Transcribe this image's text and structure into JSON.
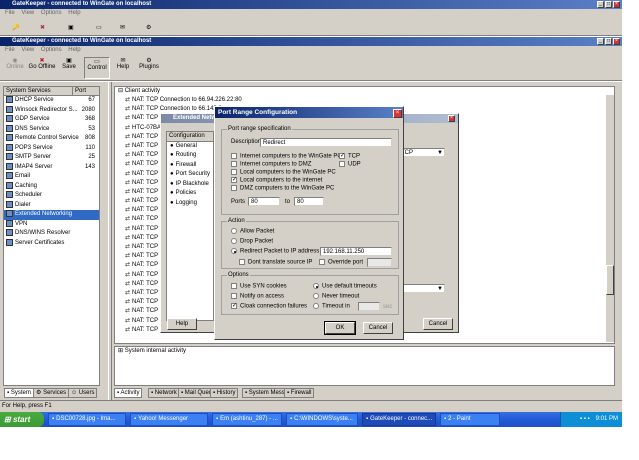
{
  "outer_window": {
    "title": "GateKeeper - connected to WinGate on localhost",
    "menu": [
      "File",
      "View",
      "Options",
      "Help"
    ]
  },
  "inner_window": {
    "title": "GateKeeper - connected to WinGate on localhost",
    "menu": [
      "File",
      "View",
      "Options",
      "Help"
    ],
    "toolbar": [
      "Online",
      "Go Offline",
      "Save",
      "Control",
      "Help",
      "Plugins"
    ]
  },
  "services": {
    "col_service": "System Services",
    "col_port": "Port",
    "items": [
      {
        "name": "DHCP Service",
        "port": "67"
      },
      {
        "name": "Winsock Redirector S...",
        "port": "2080"
      },
      {
        "name": "GDP Service",
        "port": "368"
      },
      {
        "name": "DNS Service",
        "port": "53"
      },
      {
        "name": "Remote Control Service",
        "port": "808"
      },
      {
        "name": "POP3 Service",
        "port": "110"
      },
      {
        "name": "SMTP Server",
        "port": "25"
      },
      {
        "name": "IMAP4 Server",
        "port": "143"
      },
      {
        "name": "Email",
        "port": ""
      },
      {
        "name": "Caching",
        "port": ""
      },
      {
        "name": "Scheduler",
        "port": ""
      },
      {
        "name": "Dialer",
        "port": ""
      },
      {
        "name": "Extended Networking",
        "port": ""
      },
      {
        "name": "VPN",
        "port": ""
      },
      {
        "name": "DNS/WINS Resolver",
        "port": ""
      },
      {
        "name": "Server Certificates",
        "port": ""
      }
    ],
    "tabs": [
      "System",
      "Services",
      "Users"
    ]
  },
  "activity": {
    "header": "Client activity",
    "lines": [
      "NAT: TCP Connection to 66.94.226.22:80",
      "NAT: TCP Connection to 66.142.2...",
      "NAT: TCP C",
      "HTC-07BAGE",
      "NAT: TCP C",
      "NAT: TCP C",
      "NAT: TCP C",
      "NAT: TCP C",
      "NAT: TCP C",
      "NAT: TCP C",
      "NAT: TCP C",
      "NAT: TCP C",
      "NAT: TCP C",
      "NAT: TCP C",
      "NAT: TCP C",
      "NAT: TCP C",
      "NAT: TCP C",
      "NAT: TCP C",
      "NAT: TCP C",
      "NAT: TCP C",
      "NAT: TCP C",
      "NAT: TCP C",
      "NAT: TCP C",
      "NAT: TCP C",
      "NAT: TCP C",
      "NAT: TCP Connection to 66.142.2..."
    ],
    "system_header": "System internal activity",
    "bottom_tabs": [
      "Activity",
      "Network",
      "Mail Queue",
      "History",
      "System Messages",
      "Firewall"
    ]
  },
  "extended_dialog": {
    "title": "Extended Netw",
    "nav": [
      "Configuration",
      "General",
      "Routing",
      "Firewall",
      "Port Security",
      "IP Blackhole",
      "Policies",
      "Logging"
    ],
    "tcp_value": "TCP",
    "help": "Help",
    "cancel": "Cancel"
  },
  "port_dialog": {
    "title": "Port Range Configuration",
    "spec_group": "Port range specification",
    "description_label": "Description",
    "description_value": "Redirect",
    "checks": [
      {
        "label": "Internet computers to the WinGate PC",
        "on": false
      },
      {
        "label": "Internet computers to DMZ",
        "on": false
      },
      {
        "label": "Local computers to the WinGate PC",
        "on": false
      },
      {
        "label": "Local computers to the internet",
        "on": true
      },
      {
        "label": "DMZ computers to the WinGate PC",
        "on": false
      }
    ],
    "tcp_label": "TCP",
    "udp_label": "UDP",
    "ports_label": "Ports",
    "port_from": "80",
    "to_label": "to",
    "port_to": "80",
    "action_group": "Action",
    "allow": "Allow Packet",
    "drop": "Drop Packet",
    "redirect": "Redirect Packet to IP address",
    "redirect_ip": "192.168.11.250",
    "dont_translate": "Dont translate source IP",
    "override_port": "Override port",
    "options_group": "Options",
    "use_syn": "Use SYN cookies",
    "use_default_timeouts": "Use default timeouts",
    "notify": "Notify on access",
    "never_timeout": "Never timeout",
    "cloak": "Cloak connection failures",
    "timeout_in": "Timeout in",
    "timeout_unit": "sec",
    "ok": "OK",
    "cancel": "Cancel"
  },
  "status_bar": "For Help, press F1",
  "taskbar": {
    "start": "start",
    "buttons": [
      "DSC00728.jpg - Ima...",
      "Yahoo! Messenger",
      "Em (ashtinu_287) - ...",
      "C:\\WINDOWS\\syste...",
      "GateKeeper - connec...",
      "2 - Paint"
    ],
    "clock": "9:01 PM"
  },
  "colors": {
    "title_blue": "#0a246a",
    "face": "#d4d0c8",
    "taskbar": "#245edb",
    "start": "#3c9a34"
  }
}
